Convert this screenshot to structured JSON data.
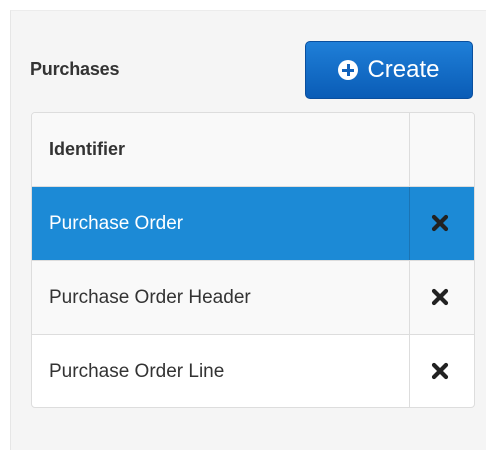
{
  "panel": {
    "title": "Purchases",
    "create_button": {
      "label": "Create",
      "icon": "plus-circle-icon"
    }
  },
  "table": {
    "columns": [
      "Identifier",
      ""
    ],
    "rows": [
      {
        "identifier": "Purchase Order",
        "selected": true,
        "action_icon": "delete-icon"
      },
      {
        "identifier": "Purchase Order Header",
        "selected": false,
        "action_icon": "delete-icon"
      },
      {
        "identifier": "Purchase Order Line",
        "selected": false,
        "action_icon": "delete-icon"
      }
    ]
  },
  "colors": {
    "accent": "#1c8ad6",
    "button": "#0a5cb6",
    "text": "#333333"
  }
}
